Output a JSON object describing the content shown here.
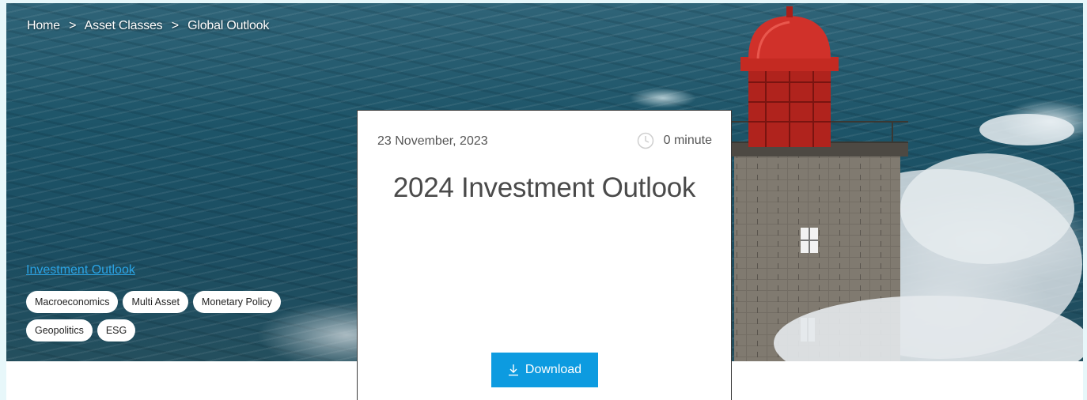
{
  "breadcrumb": {
    "items": [
      "Home",
      "Asset Classes",
      "Global Outlook"
    ],
    "separator": ">"
  },
  "article": {
    "category": "Investment Outlook",
    "tags": [
      "Macroeconomics",
      "Multi Asset",
      "Monetary Policy",
      "Geopolitics",
      "ESG"
    ],
    "date": "23 November, 2023",
    "read_time": "0 minute",
    "title": "2024 Investment Outlook",
    "download_label": "Download"
  },
  "icons": {
    "read_time": "clock-icon",
    "download": "download-icon"
  },
  "colors": {
    "accent": "#0d9be0",
    "link": "#2aa4e6",
    "page_bg": "#e7f7fa",
    "lighthouse_dome": "#c8231c"
  }
}
